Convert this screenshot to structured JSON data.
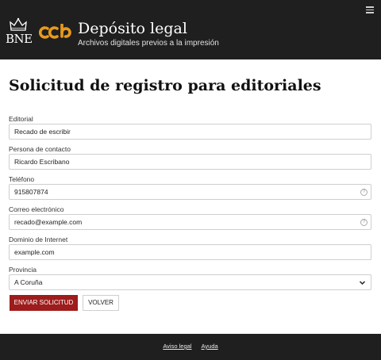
{
  "header": {
    "bne_logo_text": "BNE",
    "ccb_logo_text": "ccb",
    "title": "Depósito legal",
    "subtitle": "Archivos digitales previos a la impresión",
    "menu_icon": "hamburger-menu-icon"
  },
  "page": {
    "title": "Solicitud de registro para editoriales"
  },
  "form": {
    "editorial": {
      "label": "Editorial",
      "value": "Recado de escribir"
    },
    "contact": {
      "label": "Persona de contacto",
      "value": "Ricardo Escribano"
    },
    "phone": {
      "label": "Teléfono",
      "value": "915807874",
      "icon": "help-icon"
    },
    "email": {
      "label": "Correo electrónico",
      "value": "recado@example.com",
      "icon": "help-icon"
    },
    "domain": {
      "label": "Dominio de Internet",
      "value": "example.com"
    },
    "province": {
      "label": "Provincia",
      "selected": "A Coruña",
      "icon": "chevron-down-icon"
    }
  },
  "buttons": {
    "submit": "ENVIAR SOLICITUD",
    "back": "VOLVER"
  },
  "footer": {
    "legal": "Aviso legal",
    "help": "Ayuda"
  },
  "colors": {
    "header_bg": "#1f1f1f",
    "primary_button": "#9e1c1c",
    "ccb_logo": "#e89a1c",
    "field_border": "#cfcfcf"
  }
}
